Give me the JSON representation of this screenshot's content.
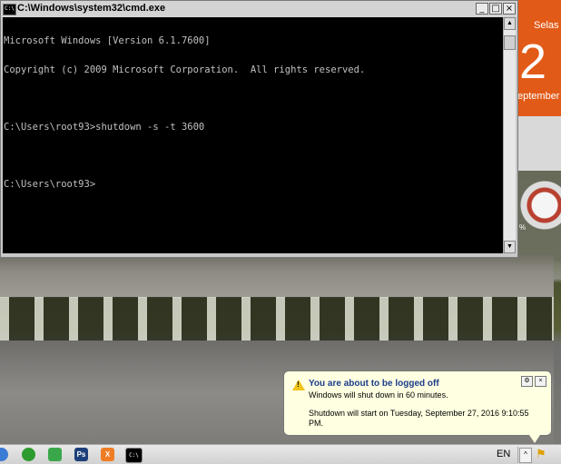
{
  "window": {
    "title": "C:\\Windows\\system32\\cmd.exe",
    "icon_label": "C:\\",
    "minimize": "_",
    "maximize": "□",
    "close": "×"
  },
  "console": {
    "lines": [
      "Microsoft Windows [Version 6.1.7600]",
      "Copyright (c) 2009 Microsoft Corporation.  All rights reserved.",
      "",
      "C:\\Users\\root93>shutdown -s -t 3600",
      "",
      "C:\\Users\\root93>"
    ]
  },
  "scrollbar": {
    "up": "▲",
    "down": "▼"
  },
  "gadgets": {
    "calendar": {
      "day_name": "Selas",
      "day_number": "2",
      "month": "eptember"
    },
    "gauge": {
      "percent": "%"
    }
  },
  "notification": {
    "icon": "warning-icon",
    "title": "You are about to be logged off",
    "subtitle": "Windows will shut down in 60 minutes.",
    "detail": "Shutdown will start on Tuesday, September 27, 2016 9:10:55 PM.",
    "close": "×"
  },
  "taskbar": {
    "items": [
      {
        "name": "start-icon",
        "label": ""
      },
      {
        "name": "chrome-icon",
        "label": ""
      },
      {
        "name": "green-app-icon",
        "label": ""
      },
      {
        "name": "photoshop-icon",
        "label": "Ps"
      },
      {
        "name": "xampp-icon",
        "label": "X"
      },
      {
        "name": "cmd-icon",
        "label": "C:\\"
      }
    ],
    "language": "EN",
    "tray_arrow": "^"
  },
  "colors": {
    "console_bg": "#000000",
    "console_fg": "#c0c0c0",
    "calendar_orange": "#e25a18",
    "balloon_bg": "#ffffe1"
  }
}
